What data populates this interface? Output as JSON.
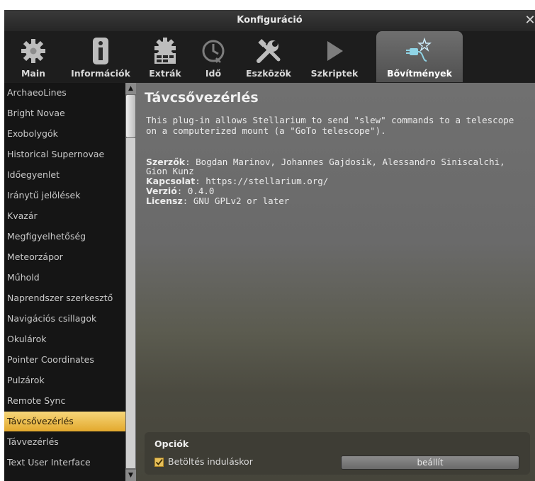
{
  "window": {
    "title": "Konfiguráció",
    "close_glyph": "✕"
  },
  "tabs": [
    {
      "label": "Main",
      "icon": "gear-icon"
    },
    {
      "label": "Információk",
      "icon": "info-icon"
    },
    {
      "label": "Extrák",
      "icon": "gear-grid-icon"
    },
    {
      "label": "Idő",
      "icon": "clock-icon"
    },
    {
      "label": "Eszközök",
      "icon": "tools-icon"
    },
    {
      "label": "Szkriptek",
      "icon": "play-icon"
    },
    {
      "label": "Bővítmények",
      "icon": "plugin-icon",
      "active": true
    }
  ],
  "plugins": [
    "ArchaeoLines",
    "Bright Novae",
    "Exobolygók",
    "Historical Supernovae",
    "Időegyenlet",
    "Iránytű jelölések",
    "Kvazár",
    "Megfigyelhetőség",
    "Meteorzápor",
    "Műhold",
    "Naprendszer szerkesztő",
    "Navigációs csillagok",
    "Okulárok",
    "Pointer Coordinates",
    "Pulzárok",
    "Remote Sync",
    "Távcsővezérlés",
    "Távvezérlés",
    "Text User Interface"
  ],
  "selected_plugin": "Távcsővezérlés",
  "detail": {
    "title": "Távcsővezérlés",
    "description": "This plug-in allows Stellarium to send \"slew\" commands to a telescope on a computerized mount (a \"GoTo telescope\").",
    "authors_label": "Szerzők",
    "authors": ": Bogdan Marinov, Johannes Gajdosik, Alessandro Siniscalchi, Gion Kunz",
    "contact_label": "Kapcsolat",
    "contact": ": https://stellarium.org/",
    "version_label": "Verzió",
    "version": ": 0.4.0",
    "license_label": "Licensz",
    "license": ": GNU GPLv2 or later"
  },
  "options": {
    "heading": "Opciók",
    "load_at_startup_label": "Betöltés induláskor",
    "load_at_startup_checked": true,
    "configure_label": "beállít"
  },
  "colors": {
    "selected_item": "#e8b548",
    "active_tab": "#666666",
    "background": "#1f1f1f"
  }
}
